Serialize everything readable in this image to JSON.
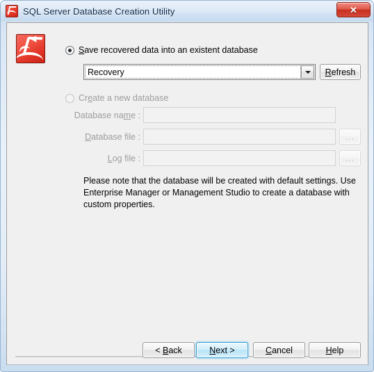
{
  "window": {
    "title": "SQL Server Database Creation Utility",
    "app_icon": "recovery-toolbox-icon",
    "close_label": "✕"
  },
  "options": {
    "existing": {
      "label_pre": "S",
      "label_post": "ave recovered data into an existent database",
      "full_label": "Save recovered data into an existent database",
      "selected": true
    },
    "create_new": {
      "label_pre": "Cr",
      "label_acc": "e",
      "label_post": "ate a new database",
      "full_label": "Create a new database",
      "selected": false
    }
  },
  "database_combo": {
    "value": "Recovery",
    "arrow_icon": "chevron-down-icon"
  },
  "refresh_button": {
    "acc": "R",
    "rest": "efresh",
    "full_label": "Refresh"
  },
  "fields": [
    {
      "name": "database-name",
      "label_pre": "Database na",
      "label_acc": "m",
      "label_post": "e :",
      "full_label": "Database name :",
      "value": "",
      "disabled": true,
      "has_browse": false
    },
    {
      "name": "database-file",
      "label_pre": "",
      "label_acc": "D",
      "label_post": "atabase file :",
      "full_label": "Database file :",
      "value": "",
      "disabled": true,
      "has_browse": true
    },
    {
      "name": "log-file",
      "label_pre": "",
      "label_acc": "L",
      "label_post": "og file :",
      "full_label": "Log file :",
      "value": "",
      "disabled": true,
      "has_browse": true
    }
  ],
  "browse_button_label": "...",
  "note": "Please note that the database will be created with default settings. Use Enterprise Manager or Management Studio to create a database with custom properties.",
  "footer_buttons": [
    {
      "name": "back-button",
      "pre": "< ",
      "acc": "B",
      "post": "ack",
      "full_label": "< Back",
      "default": false,
      "disabled": false
    },
    {
      "name": "next-button",
      "pre": "",
      "acc": "N",
      "post": "ext >",
      "full_label": "Next >",
      "default": true,
      "disabled": false
    },
    {
      "name": "cancel-button",
      "pre": "",
      "acc": "C",
      "post": "ancel",
      "full_label": "Cancel",
      "default": false,
      "disabled": false
    },
    {
      "name": "help-button",
      "pre": "",
      "acc": "H",
      "post": "elp",
      "full_label": "Help",
      "default": false,
      "disabled": false
    }
  ],
  "colors": {
    "accent_red": "#e13426",
    "default_button_border": "#2e9bd0",
    "window_glass": "#cfe0f2",
    "client_bg": "#f0f0f0",
    "disabled_text": "#9d9d9d"
  }
}
